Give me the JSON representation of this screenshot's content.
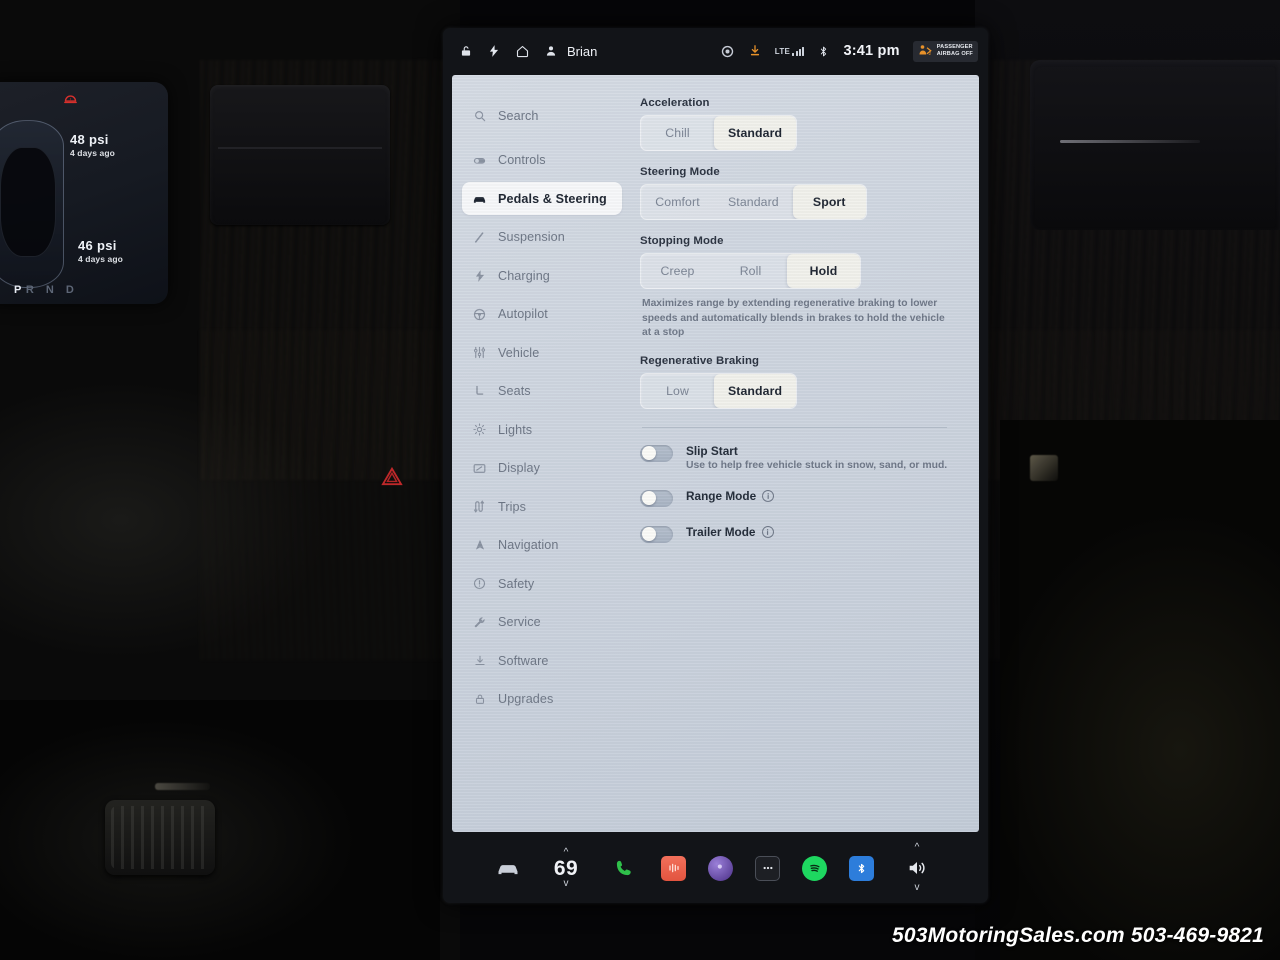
{
  "instrument_cluster": {
    "tire_front": {
      "pressure": "48 psi",
      "age": "4 days ago"
    },
    "tire_rear": {
      "pressure": "46 psi",
      "age": "4 days ago"
    },
    "gear_selected": "P",
    "gear_rest": "R N D",
    "tpms_warning_icon": "tire-pressure-warning-icon"
  },
  "hazard_button": {
    "icon": "hazard-triangle-icon"
  },
  "status_bar": {
    "lock_icon": "lock-icon",
    "charge_icon": "lightning-bolt-icon",
    "home_icon": "home-icon",
    "profile_icon": "person-icon",
    "driver_name": "Brian",
    "sentry_icon": "camera-circle-icon",
    "download_icon": "download-arrow-icon",
    "network_label": "LTE",
    "signal_icon": "signal-bars-icon",
    "bluetooth_icon": "bluetooth-icon",
    "time": "3:41 pm",
    "airbag_icon": "passenger-airbag-icon",
    "airbag_line1": "PASSENGER",
    "airbag_line2": "AIRBAG OFF"
  },
  "sidebar": {
    "items": [
      {
        "label": "Search",
        "icon": "search-icon",
        "active": false
      },
      {
        "label": "Controls",
        "icon": "toggle-icon",
        "active": false
      },
      {
        "label": "Pedals & Steering",
        "icon": "car-icon",
        "active": true
      },
      {
        "label": "Suspension",
        "icon": "suspension-icon",
        "active": false
      },
      {
        "label": "Charging",
        "icon": "lightning-bolt-icon",
        "active": false
      },
      {
        "label": "Autopilot",
        "icon": "steering-wheel-icon",
        "active": false
      },
      {
        "label": "Vehicle",
        "icon": "sliders-icon",
        "active": false
      },
      {
        "label": "Seats",
        "icon": "seat-icon",
        "active": false
      },
      {
        "label": "Lights",
        "icon": "sun-icon",
        "active": false
      },
      {
        "label": "Display",
        "icon": "display-icon",
        "active": false
      },
      {
        "label": "Trips",
        "icon": "trips-icon",
        "active": false
      },
      {
        "label": "Navigation",
        "icon": "navigation-arrow-icon",
        "active": false
      },
      {
        "label": "Safety",
        "icon": "alert-circle-icon",
        "active": false
      },
      {
        "label": "Service",
        "icon": "wrench-icon",
        "active": false
      },
      {
        "label": "Software",
        "icon": "download-arrow-icon",
        "active": false
      },
      {
        "label": "Upgrades",
        "icon": "lock-icon",
        "active": false
      }
    ]
  },
  "settings": {
    "acceleration": {
      "label": "Acceleration",
      "options": [
        "Chill",
        "Standard"
      ],
      "selected": "Standard"
    },
    "steering_mode": {
      "label": "Steering Mode",
      "options": [
        "Comfort",
        "Standard",
        "Sport"
      ],
      "selected": "Sport"
    },
    "stopping_mode": {
      "label": "Stopping Mode",
      "options": [
        "Creep",
        "Roll",
        "Hold"
      ],
      "selected": "Hold",
      "description": "Maximizes range by extending regenerative braking to lower speeds and automatically blends in brakes to hold the vehicle at a stop"
    },
    "regenerative_braking": {
      "label": "Regenerative Braking",
      "options": [
        "Low",
        "Standard"
      ],
      "selected": "Standard"
    },
    "toggles": [
      {
        "label": "Slip Start",
        "description": "Use to help free vehicle stuck in snow, sand, or mud.",
        "on": false,
        "has_info": false
      },
      {
        "label": "Range Mode",
        "description": "",
        "on": false,
        "has_info": true
      },
      {
        "label": "Trailer Mode",
        "description": "",
        "on": false,
        "has_info": true
      }
    ]
  },
  "dock": {
    "car_icon": "car-icon",
    "temperature": "69",
    "temp_up_icon": "chevron-up-icon",
    "temp_down_icon": "chevron-down-icon",
    "phone_icon": "phone-icon",
    "media_icon": "media-equalizer-icon",
    "slacker_icon": "slacker-radio-icon",
    "more_icon": "more-dots-icon",
    "spotify_icon": "spotify-icon",
    "bluetooth_icon": "bluetooth-icon",
    "volume_icon": "volume-icon",
    "volume_up_icon": "chevron-up-icon",
    "volume_down_icon": "chevron-down-icon"
  },
  "watermark": {
    "text": "503MotoringSales.com 503-469-9821"
  },
  "colors": {
    "panel_bg": "#cfd6e0",
    "selected_pill": "#f1f1ec",
    "accent_orange": "#e8922a",
    "spotify_green": "#1ed760",
    "bluetooth_blue": "#2d7ddb",
    "hazard_red": "#c0282a"
  }
}
